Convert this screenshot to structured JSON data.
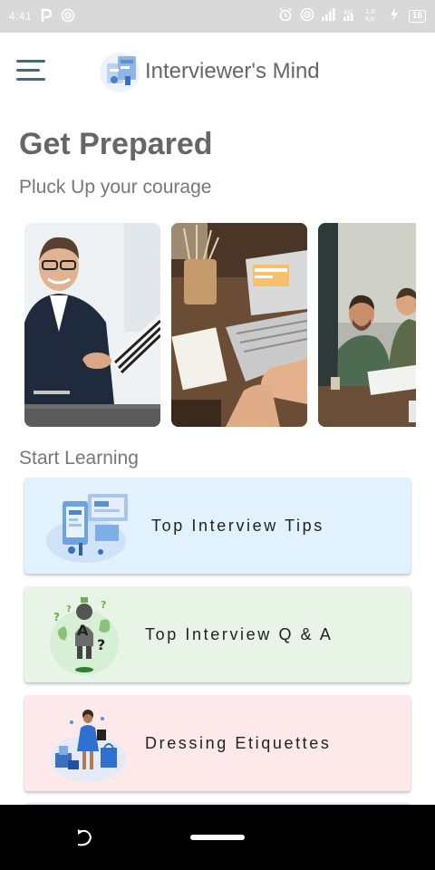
{
  "status_bar": {
    "time": "4:41",
    "battery": "16",
    "network_label": "4G"
  },
  "app_bar": {
    "title": "Interviewer's Mind",
    "menu_icon": "hamburger-menu-icon",
    "logo_icon": "app-logo-icon"
  },
  "hero": {
    "title": "Get Prepared",
    "subtitle": "Pluck Up your courage"
  },
  "carousel": {
    "slides": [
      {
        "name": "handshake-photo"
      },
      {
        "name": "laptop-desk-photo"
      },
      {
        "name": "meeting-photo"
      }
    ]
  },
  "learning": {
    "section_title": "Start Learning",
    "cards": [
      {
        "label": "Top Interview Tips",
        "color": "#e1f1fd",
        "icon": "tips-illustration-icon"
      },
      {
        "label": "Top Interview Q & A",
        "color": "#e7f4e6",
        "icon": "question-answer-illustration-icon"
      },
      {
        "label": "Dressing Etiquettes",
        "color": "#fde8ea",
        "icon": "dressing-illustration-icon"
      }
    ]
  }
}
